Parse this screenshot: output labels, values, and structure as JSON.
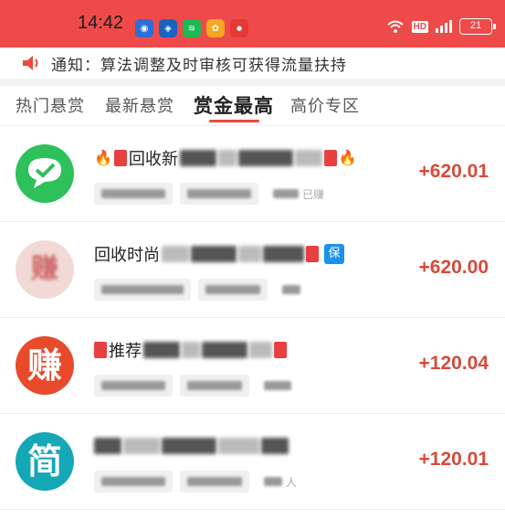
{
  "status_bar": {
    "time": "14:42",
    "hd_label": "HD",
    "battery": "21"
  },
  "notice": {
    "label": "通知：",
    "text": "算法调整及时审核可获得流量扶持"
  },
  "tabs": [
    {
      "label": "热门悬赏",
      "active": false
    },
    {
      "label": "最新悬赏",
      "active": false
    },
    {
      "label": "赏金最高",
      "active": true
    },
    {
      "label": "高价专区",
      "active": false
    }
  ],
  "tasks": [
    {
      "title_prefix": "回收新",
      "avatar_char": "",
      "avatar_color": "#2ec05a",
      "amount": "+620.01",
      "tag": "",
      "sub_hint": "已赚"
    },
    {
      "title_prefix": "回收时尚",
      "avatar_char": "赚",
      "avatar_color": "#f2d9d5",
      "amount": "+620.00",
      "tag": "保",
      "sub_hint": ""
    },
    {
      "title_prefix": "推荐",
      "avatar_char": "赚",
      "avatar_color": "#e84b2c",
      "amount": "+120.04",
      "tag": "",
      "sub_hint": ""
    },
    {
      "title_prefix": "",
      "avatar_char": "简",
      "avatar_color": "#14a7b6",
      "amount": "+120.01",
      "tag": "",
      "sub_hint": "人"
    }
  ],
  "colors": {
    "accent": "#ee4a4a",
    "amount": "#d74a3a"
  }
}
